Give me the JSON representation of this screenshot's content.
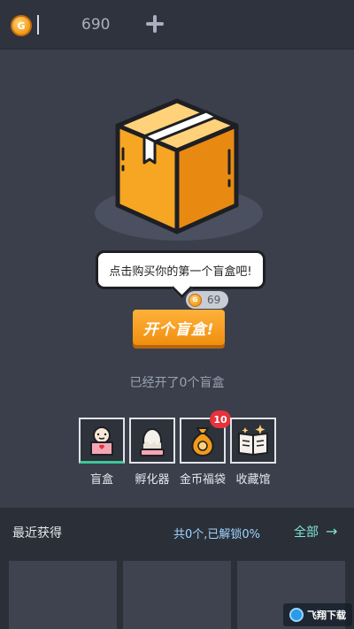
{
  "topbar": {
    "coin_icon_letter": "G",
    "coin_amount": "690",
    "add_icon": "plus-icon"
  },
  "hero": {
    "speech_text": "点击购买你的第一个盲盒吧!",
    "price": "69",
    "price_coin_letter": "G",
    "open_button_label": "开个盲盒!",
    "opened_count_text": "已经开了0个盲盒"
  },
  "categories": [
    {
      "label": "盲盒",
      "icon": "blind-box-doll-icon",
      "active": true
    },
    {
      "label": "孵化器",
      "icon": "egg-incubator-icon",
      "active": false
    },
    {
      "label": "金币福袋",
      "icon": "coin-bag-icon",
      "badge": "10",
      "active": false
    },
    {
      "label": "收藏馆",
      "icon": "collection-book-icon",
      "active": false
    }
  ],
  "recent": {
    "title": "最近获得",
    "summary": "共0个,已解锁0%",
    "view_all_label": "全部",
    "view_all_arrow": "→"
  },
  "watermark": {
    "text": "飞翔下载"
  },
  "colors": {
    "background": "#3a3f4b",
    "accent_orange": "#f29b19",
    "accent_teal": "#7ee6d6",
    "badge_red": "#e5323c"
  }
}
